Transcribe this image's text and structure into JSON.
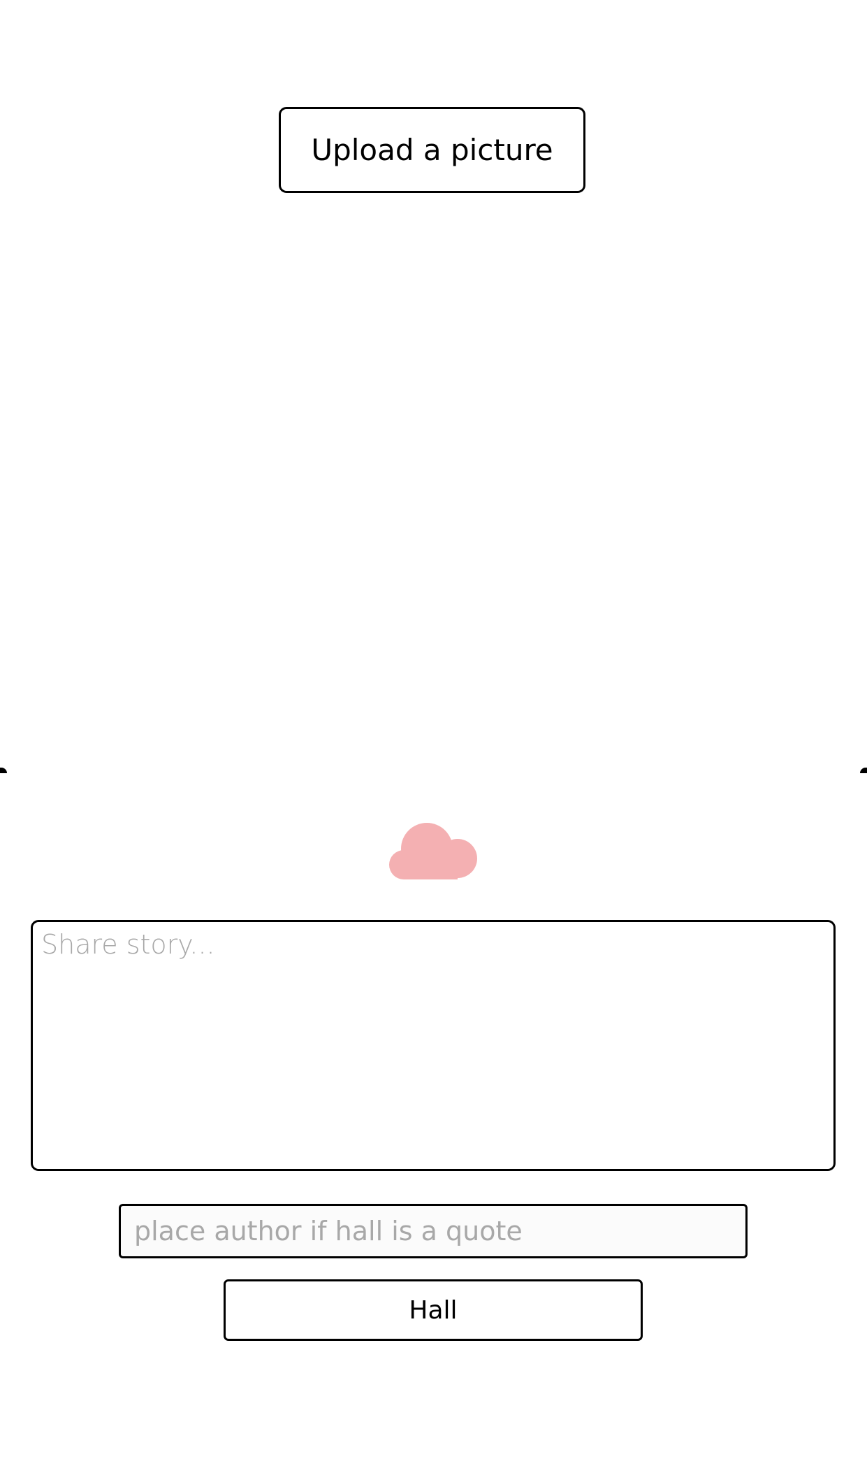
{
  "upload": {
    "button_label": "Upload a picture"
  },
  "icons": {
    "cloud": "cloud-icon"
  },
  "colors": {
    "cloud": "#f4b0b2",
    "border": "#000000",
    "placeholder": "#a8a8a8"
  },
  "story": {
    "placeholder": "Share story...",
    "value": ""
  },
  "author": {
    "placeholder": "place author if hall is a quote",
    "value": ""
  },
  "submit": {
    "label": "Hall"
  }
}
